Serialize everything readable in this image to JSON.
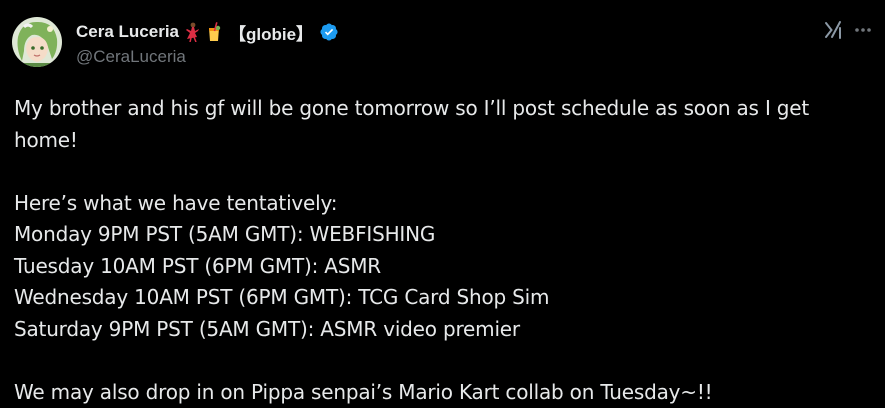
{
  "author": {
    "display_name": "Cera Luceria",
    "name_suffix": "【globie】",
    "handle": "@CeraLuceria",
    "emojis": [
      "dancer-emoji",
      "drink-emoji"
    ],
    "verified_color": "#1d9bf0"
  },
  "actions": {
    "grok_icon": "grok-icon",
    "more_icon": "more-options-icon"
  },
  "tweet": {
    "lines": [
      "My brother and his gf will be gone tomorrow so I’ll post schedule as soon as I get",
      "home!",
      "",
      "Here’s what we have tentatively:",
      "Monday 9PM PST (5AM GMT): WEBFISHING",
      "Tuesday 10AM PST (6PM GMT): ASMR",
      "Wednesday 10AM PST (6PM GMT): TCG Card Shop Sim",
      "Saturday 9PM PST (5AM GMT): ASMR video premier",
      "",
      "We may also drop in on Pippa senpai’s Mario Kart collab on Tuesday~!!"
    ]
  },
  "colors": {
    "background": "#000000",
    "text": "#e7e9ea",
    "secondary": "#71767b",
    "accent": "#1d9bf0"
  }
}
